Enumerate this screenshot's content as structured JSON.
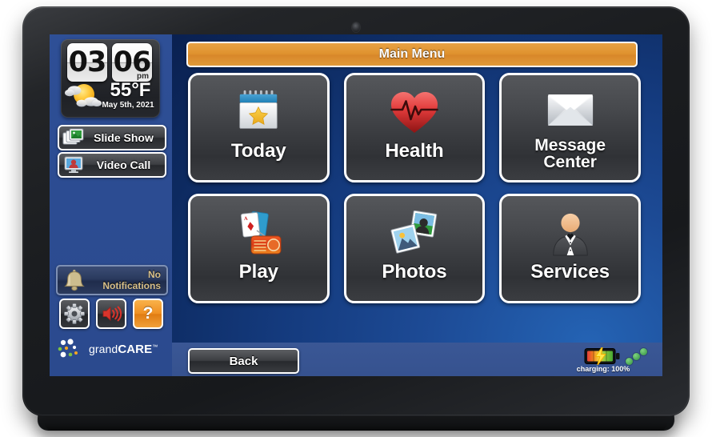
{
  "device": {
    "name": "grandCARE tablet",
    "camera": "front-camera"
  },
  "clock": {
    "hours": "03",
    "minutes": "06",
    "ampm": "pm",
    "temperature": "55°F",
    "date": "May 5th, 2021",
    "weather_icon": "sun-behind-cloud-icon"
  },
  "sidebar": {
    "buttons": [
      {
        "label": "Slide Show",
        "icon": "photo-stack-icon"
      },
      {
        "label": "Video Call",
        "icon": "video-call-icon"
      }
    ],
    "notification": {
      "label": "No Notifications",
      "icon": "bell-icon"
    },
    "system_buttons": [
      {
        "name": "settings",
        "icon": "gear-icon",
        "glyph": ""
      },
      {
        "name": "volume",
        "icon": "speaker-icon",
        "glyph": ""
      },
      {
        "name": "help",
        "icon": "question-mark-icon",
        "glyph": "?"
      }
    ],
    "logo": {
      "prefix": "grand",
      "suffix": "CARE",
      "trademark": "™"
    }
  },
  "header": {
    "title": "Main Menu"
  },
  "menu": {
    "tiles": [
      {
        "label": "Today",
        "icon": "calendar-star-icon",
        "lines": 1
      },
      {
        "label": "Health",
        "icon": "heart-pulse-icon",
        "lines": 1
      },
      {
        "label": "Message\nCenter",
        "line1": "Message",
        "line2": "Center",
        "icon": "envelope-icon",
        "lines": 2
      },
      {
        "label": "Play",
        "icon": "cards-radio-icon",
        "lines": 1
      },
      {
        "label": "Photos",
        "icon": "photos-icon",
        "lines": 1
      },
      {
        "label": "Services",
        "icon": "concierge-person-icon",
        "lines": 1
      }
    ]
  },
  "footer": {
    "back_label": "Back",
    "battery": {
      "status_text": "charging: 100%",
      "icon": "battery-charging-icon",
      "level": 100
    },
    "signal": {
      "icon": "signal-dots-icon",
      "dots": 3
    }
  },
  "colors": {
    "accent_orange": "#e0932f",
    "screen_blue": "#1d4b96",
    "sidebar_blue": "#2c4c92",
    "tile_gray": "#3a3c40",
    "notification_text": "#d8c08a"
  }
}
